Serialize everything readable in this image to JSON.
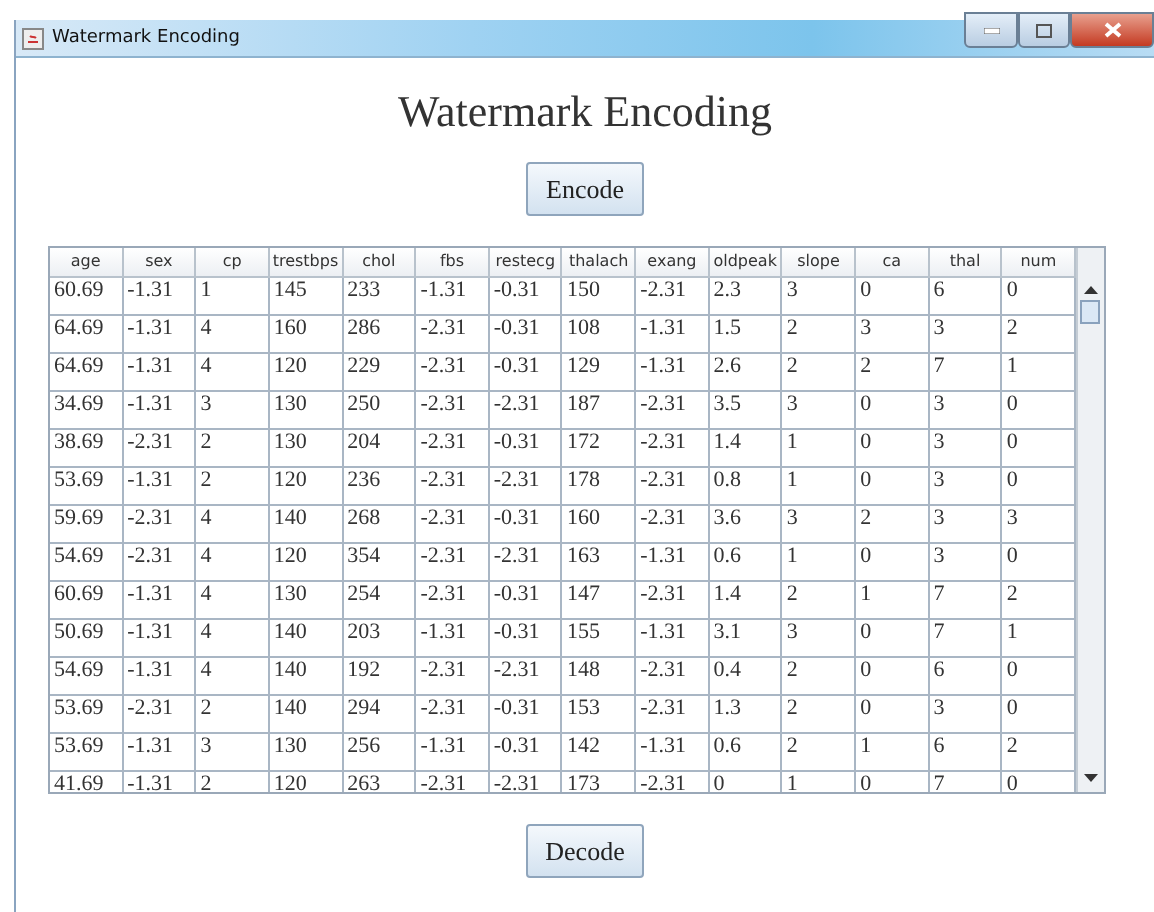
{
  "window": {
    "title": "Watermark Encoding"
  },
  "heading": "Watermark Encoding",
  "encode_button": "Encode",
  "table": {
    "columns": [
      "age",
      "sex",
      "cp",
      "trestbps",
      "chol",
      "fbs",
      "restecg",
      "thalach",
      "exang",
      "oldpeak",
      "slope",
      "ca",
      "thal",
      "num"
    ],
    "rows": [
      [
        "60.69",
        "-1.31",
        "1",
        "145",
        "233",
        "-1.31",
        "-0.31",
        "150",
        "-2.31",
        "2.3",
        "3",
        "0",
        "6",
        "0"
      ],
      [
        "64.69",
        "-1.31",
        "4",
        "160",
        "286",
        "-2.31",
        "-0.31",
        "108",
        "-1.31",
        "1.5",
        "2",
        "3",
        "3",
        "2"
      ],
      [
        "64.69",
        "-1.31",
        "4",
        "120",
        "229",
        "-2.31",
        "-0.31",
        "129",
        "-1.31",
        "2.6",
        "2",
        "2",
        "7",
        "1"
      ],
      [
        "34.69",
        "-1.31",
        "3",
        "130",
        "250",
        "-2.31",
        "-2.31",
        "187",
        "-2.31",
        "3.5",
        "3",
        "0",
        "3",
        "0"
      ],
      [
        "38.69",
        "-2.31",
        "2",
        "130",
        "204",
        "-2.31",
        "-0.31",
        "172",
        "-2.31",
        "1.4",
        "1",
        "0",
        "3",
        "0"
      ],
      [
        "53.69",
        "-1.31",
        "2",
        "120",
        "236",
        "-2.31",
        "-2.31",
        "178",
        "-2.31",
        "0.8",
        "1",
        "0",
        "3",
        "0"
      ],
      [
        "59.69",
        "-2.31",
        "4",
        "140",
        "268",
        "-2.31",
        "-0.31",
        "160",
        "-2.31",
        "3.6",
        "3",
        "2",
        "3",
        "3"
      ],
      [
        "54.69",
        "-2.31",
        "4",
        "120",
        "354",
        "-2.31",
        "-2.31",
        "163",
        "-1.31",
        "0.6",
        "1",
        "0",
        "3",
        "0"
      ],
      [
        "60.69",
        "-1.31",
        "4",
        "130",
        "254",
        "-2.31",
        "-0.31",
        "147",
        "-2.31",
        "1.4",
        "2",
        "1",
        "7",
        "2"
      ],
      [
        "50.69",
        "-1.31",
        "4",
        "140",
        "203",
        "-1.31",
        "-0.31",
        "155",
        "-1.31",
        "3.1",
        "3",
        "0",
        "7",
        "1"
      ],
      [
        "54.69",
        "-1.31",
        "4",
        "140",
        "192",
        "-2.31",
        "-2.31",
        "148",
        "-2.31",
        "0.4",
        "2",
        "0",
        "6",
        "0"
      ],
      [
        "53.69",
        "-2.31",
        "2",
        "140",
        "294",
        "-2.31",
        "-0.31",
        "153",
        "-2.31",
        "1.3",
        "2",
        "0",
        "3",
        "0"
      ],
      [
        "53.69",
        "-1.31",
        "3",
        "130",
        "256",
        "-1.31",
        "-0.31",
        "142",
        "-1.31",
        "0.6",
        "2",
        "1",
        "6",
        "2"
      ],
      [
        "41.69",
        "-1.31",
        "2",
        "120",
        "263",
        "-2.31",
        "-2.31",
        "173",
        "-2.31",
        "0",
        "1",
        "0",
        "7",
        "0"
      ]
    ]
  },
  "decode_button": "Decode"
}
